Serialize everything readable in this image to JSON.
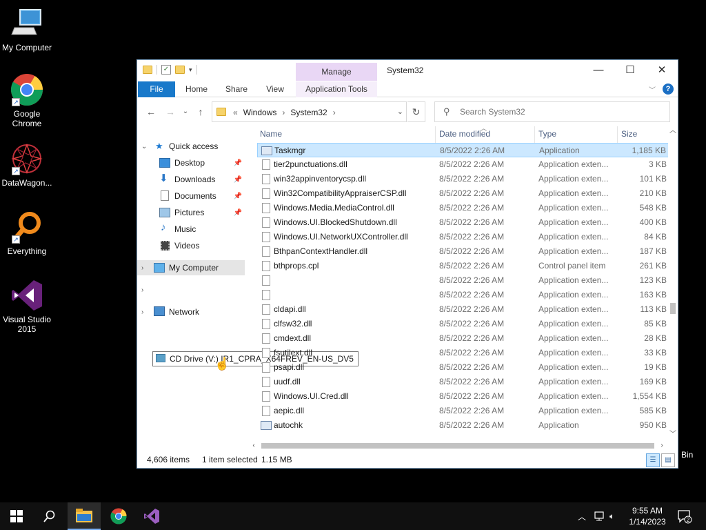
{
  "desktop": {
    "icons": [
      {
        "label": "My Computer",
        "icon": "monitor-icon"
      },
      {
        "label": "Google Chrome",
        "icon": "chrome-icon"
      },
      {
        "label": "DataWagon...",
        "icon": "datawagon-icon"
      },
      {
        "label": "Everything",
        "icon": "magnifier-icon"
      },
      {
        "label": "Visual Studio 2015",
        "icon": "visual-studio-icon"
      }
    ],
    "recycle_bin_label": "Bin"
  },
  "window": {
    "title": "System32",
    "manage_tab": "Manage",
    "caption_buttons": {
      "minimize": "—",
      "maximize": "☐",
      "close": "✕"
    },
    "ribbon_tabs": [
      {
        "label": "File"
      },
      {
        "label": "Home"
      },
      {
        "label": "Share"
      },
      {
        "label": "View"
      },
      {
        "label": "Application Tools"
      }
    ],
    "help_label": "?",
    "address": {
      "prefix": "«",
      "crumbs": [
        "Windows",
        "System32"
      ],
      "sep": "›"
    },
    "search": {
      "placeholder": "Search System32"
    },
    "nav_pane": {
      "quick_access": "Quick access",
      "items": [
        {
          "label": "Desktop",
          "icon": "desktop-icon",
          "pinned": true
        },
        {
          "label": "Downloads",
          "icon": "download-icon",
          "pinned": true
        },
        {
          "label": "Documents",
          "icon": "documents-icon",
          "pinned": true
        },
        {
          "label": "Pictures",
          "icon": "pictures-icon",
          "pinned": true
        },
        {
          "label": "Music",
          "icon": "music-icon",
          "pinned": false
        },
        {
          "label": "Videos",
          "icon": "videos-icon",
          "pinned": false
        }
      ],
      "my_computer": "My Computer",
      "cd_drive_tooltip": "CD Drive (V:) IR1_CPRA_X64FREV_EN-US_DV5",
      "network": "Network"
    },
    "columns": {
      "name": "Name",
      "date": "Date modified",
      "type": "Type",
      "size": "Size"
    },
    "files": [
      {
        "name": "Taskmgr",
        "date": "8/5/2022 2:26 AM",
        "type": "Application",
        "size": "1,185 KB",
        "kind": "app",
        "selected": true
      },
      {
        "name": "tier2punctuations.dll",
        "date": "8/5/2022 2:26 AM",
        "type": "Application exten...",
        "size": "3 KB",
        "kind": "dll"
      },
      {
        "name": "win32appinventorycsp.dll",
        "date": "8/5/2022 2:26 AM",
        "type": "Application exten...",
        "size": "101 KB",
        "kind": "dll"
      },
      {
        "name": "Win32CompatibilityAppraiserCSP.dll",
        "date": "8/5/2022 2:26 AM",
        "type": "Application exten...",
        "size": "210 KB",
        "kind": "dll"
      },
      {
        "name": "Windows.Media.MediaControl.dll",
        "date": "8/5/2022 2:26 AM",
        "type": "Application exten...",
        "size": "548 KB",
        "kind": "dll"
      },
      {
        "name": "Windows.UI.BlockedShutdown.dll",
        "date": "8/5/2022 2:26 AM",
        "type": "Application exten...",
        "size": "400 KB",
        "kind": "dll"
      },
      {
        "name": "Windows.UI.NetworkUXController.dll",
        "date": "8/5/2022 2:26 AM",
        "type": "Application exten...",
        "size": "84 KB",
        "kind": "dll"
      },
      {
        "name": "BthpanContextHandler.dll",
        "date": "8/5/2022 2:26 AM",
        "type": "Application exten...",
        "size": "187 KB",
        "kind": "dll"
      },
      {
        "name": "bthprops.cpl",
        "date": "8/5/2022 2:26 AM",
        "type": "Control panel item",
        "size": "261 KB",
        "kind": "dll"
      },
      {
        "name": "",
        "date": "8/5/2022 2:26 AM",
        "type": "Application exten...",
        "size": "123 KB",
        "kind": "dll"
      },
      {
        "name": "",
        "date": "8/5/2022 2:26 AM",
        "type": "Application exten...",
        "size": "163 KB",
        "kind": "dll"
      },
      {
        "name": "cldapi.dll",
        "date": "8/5/2022 2:26 AM",
        "type": "Application exten...",
        "size": "113 KB",
        "kind": "dll"
      },
      {
        "name": "clfsw32.dll",
        "date": "8/5/2022 2:26 AM",
        "type": "Application exten...",
        "size": "85 KB",
        "kind": "dll"
      },
      {
        "name": "cmdext.dll",
        "date": "8/5/2022 2:26 AM",
        "type": "Application exten...",
        "size": "28 KB",
        "kind": "dll"
      },
      {
        "name": "fsutilext.dll",
        "date": "8/5/2022 2:26 AM",
        "type": "Application exten...",
        "size": "33 KB",
        "kind": "dll"
      },
      {
        "name": "psapi.dll",
        "date": "8/5/2022 2:26 AM",
        "type": "Application exten...",
        "size": "19 KB",
        "kind": "dll"
      },
      {
        "name": "uudf.dll",
        "date": "8/5/2022 2:26 AM",
        "type": "Application exten...",
        "size": "169 KB",
        "kind": "dll"
      },
      {
        "name": "Windows.UI.Cred.dll",
        "date": "8/5/2022 2:26 AM",
        "type": "Application exten...",
        "size": "1,554 KB",
        "kind": "dll"
      },
      {
        "name": "aepic.dll",
        "date": "8/5/2022 2:26 AM",
        "type": "Application exten...",
        "size": "585 KB",
        "kind": "dll"
      },
      {
        "name": "autochk",
        "date": "8/5/2022 2:26 AM",
        "type": "Application",
        "size": "950 KB",
        "kind": "app"
      }
    ],
    "status": {
      "count": "4,606 items",
      "selection": "1 item selected",
      "size": "1.15 MB"
    }
  },
  "taskbar": {
    "items": [
      "start-icon",
      "search-icon",
      "file-explorer-icon",
      "chrome-icon",
      "visual-studio-icon"
    ],
    "clock_time": "9:55 AM",
    "clock_date": "1/14/2023",
    "notification_count": "2"
  },
  "colors": {
    "accent": "#1979ca",
    "selection": "#cce8ff",
    "manage_tab": "#e9d7f5"
  }
}
